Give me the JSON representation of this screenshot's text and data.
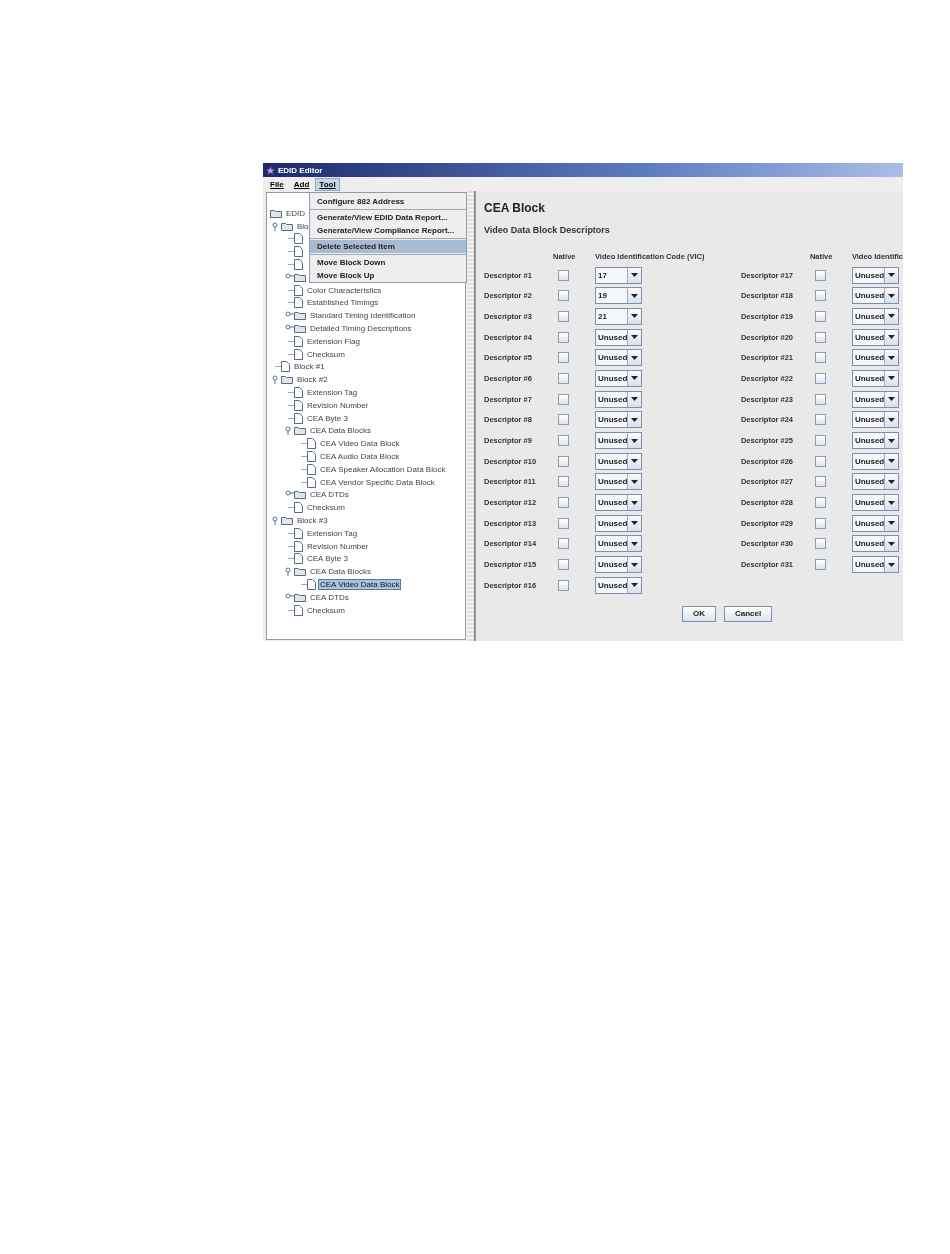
{
  "window": {
    "title": "EDID Editor"
  },
  "menu_bar": [
    {
      "label": "File",
      "selected": false
    },
    {
      "label": "Add",
      "selected": false
    },
    {
      "label": "Tool",
      "selected": true
    }
  ],
  "open_menu": {
    "items": [
      {
        "kind": "item",
        "label": "Configure 882 Address",
        "selected": false
      },
      {
        "kind": "separator"
      },
      {
        "kind": "item",
        "label": "Generate/View EDID Data Report...",
        "selected": false
      },
      {
        "kind": "item",
        "label": "Generate/View Compliance Report...",
        "selected": false
      },
      {
        "kind": "separator"
      },
      {
        "kind": "item",
        "label": "Delete Selected Item",
        "selected": true
      },
      {
        "kind": "separator"
      },
      {
        "kind": "item",
        "label": "Move Block Down",
        "selected": false
      },
      {
        "kind": "item",
        "label": "Move Block Up",
        "selected": false
      }
    ]
  },
  "tree": {
    "root": {
      "label": "EDID",
      "kind": "folder",
      "selected": false,
      "children": [
        {
          "label": "Blo",
          "kind": "folder",
          "expanded": true,
          "selected": false,
          "children": [
            {
              "kind": "file"
            },
            {
              "kind": "file"
            },
            {
              "kind": "file"
            },
            {
              "kind": "folder",
              "expanded": false
            },
            {
              "label": "Color Characteristics",
              "kind": "file",
              "selected": false
            },
            {
              "label": "Established Timings",
              "kind": "file",
              "selected": false
            },
            {
              "label": "Standard Timing Identification",
              "kind": "folder",
              "expanded": false,
              "selected": false
            },
            {
              "label": "Detailed Timing Descriptions",
              "kind": "folder",
              "expanded": false,
              "selected": false
            },
            {
              "label": "Extension Flag",
              "kind": "file",
              "selected": false
            },
            {
              "label": "Checksum",
              "kind": "file",
              "selected": false
            }
          ]
        },
        {
          "label": "Block #1",
          "kind": "file",
          "selected": false
        },
        {
          "label": "Block #2",
          "kind": "folder",
          "expanded": true,
          "selected": false,
          "children": [
            {
              "label": "Extension Tag",
              "kind": "file",
              "selected": false
            },
            {
              "label": "Revision Number",
              "kind": "file",
              "selected": false
            },
            {
              "label": "CEA Byte 3",
              "kind": "file",
              "selected": false
            },
            {
              "label": "CEA Data Blocks",
              "kind": "folder",
              "expanded": true,
              "selected": false,
              "children": [
                {
                  "label": "CEA Video Data Block",
                  "kind": "file",
                  "selected": false
                },
                {
                  "label": "CEA Audio Data Block",
                  "kind": "file",
                  "selected": false
                },
                {
                  "label": "CEA Speaker Allocation Data Block",
                  "kind": "file",
                  "selected": false
                },
                {
                  "label": "CEA Vendor Specific Data Block",
                  "kind": "file",
                  "selected": false
                }
              ]
            },
            {
              "label": "CEA DTDs",
              "kind": "folder",
              "expanded": false,
              "selected": false
            },
            {
              "label": "Checksum",
              "kind": "file",
              "selected": false
            }
          ]
        },
        {
          "label": "Block #3",
          "kind": "folder",
          "expanded": true,
          "selected": false,
          "children": [
            {
              "label": "Extension Tag",
              "kind": "file",
              "selected": false
            },
            {
              "label": "Revision Number",
              "kind": "file",
              "selected": false
            },
            {
              "label": "CEA Byte 3",
              "kind": "file",
              "selected": false
            },
            {
              "label": "CEA Data Blocks",
              "kind": "folder",
              "expanded": true,
              "selected": false,
              "children": [
                {
                  "label": "CEA Video Data Block",
                  "kind": "file",
                  "selected": true
                }
              ]
            },
            {
              "label": "CEA DTDs",
              "kind": "folder",
              "expanded": false,
              "selected": false
            },
            {
              "label": "Checksum",
              "kind": "file",
              "selected": false
            }
          ]
        }
      ]
    }
  },
  "panel": {
    "title": "CEA Block",
    "subtitle": "Video Data Block Descriptors",
    "groups": [
      {
        "native_header": "Native",
        "vic_header": "Video Identification Code (VIC)",
        "rows": [
          {
            "label": "Descriptor #1",
            "native": false,
            "vic": "17"
          },
          {
            "label": "Descriptor #2",
            "native": false,
            "vic": "19"
          },
          {
            "label": "Descriptor #3",
            "native": false,
            "vic": "21"
          },
          {
            "label": "Descriptor #4",
            "native": false,
            "vic": "Unused"
          },
          {
            "label": "Descriptor #5",
            "native": false,
            "vic": "Unused"
          },
          {
            "label": "Descriptor #6",
            "native": false,
            "vic": "Unused"
          },
          {
            "label": "Descriptor #7",
            "native": false,
            "vic": "Unused"
          },
          {
            "label": "Descriptor #8",
            "native": false,
            "vic": "Unused"
          },
          {
            "label": "Descriptor #9",
            "native": false,
            "vic": "Unused"
          },
          {
            "label": "Descriptor #10",
            "native": false,
            "vic": "Unused"
          },
          {
            "label": "Descriptor #11",
            "native": false,
            "vic": "Unused"
          },
          {
            "label": "Descriptor #12",
            "native": false,
            "vic": "Unused"
          },
          {
            "label": "Descriptor #13",
            "native": false,
            "vic": "Unused"
          },
          {
            "label": "Descriptor #14",
            "native": false,
            "vic": "Unused"
          },
          {
            "label": "Descriptor #15",
            "native": false,
            "vic": "Unused"
          },
          {
            "label": "Descriptor #16",
            "native": false,
            "vic": "Unused"
          }
        ]
      },
      {
        "native_header": "Native",
        "vic_header": "Video Identific",
        "rows": [
          {
            "label": "Descriptor #17",
            "native": false,
            "vic": "Unused"
          },
          {
            "label": "Descriptor #18",
            "native": false,
            "vic": "Unused"
          },
          {
            "label": "Descriptor #19",
            "native": false,
            "vic": "Unused"
          },
          {
            "label": "Descriptor #20",
            "native": false,
            "vic": "Unused"
          },
          {
            "label": "Descriptor #21",
            "native": false,
            "vic": "Unused"
          },
          {
            "label": "Descriptor #22",
            "native": false,
            "vic": "Unused"
          },
          {
            "label": "Descriptor #23",
            "native": false,
            "vic": "Unused"
          },
          {
            "label": "Descriptor #24",
            "native": false,
            "vic": "Unused"
          },
          {
            "label": "Descriptor #25",
            "native": false,
            "vic": "Unused"
          },
          {
            "label": "Descriptor #26",
            "native": false,
            "vic": "Unused"
          },
          {
            "label": "Descriptor #27",
            "native": false,
            "vic": "Unused"
          },
          {
            "label": "Descriptor #28",
            "native": false,
            "vic": "Unused"
          },
          {
            "label": "Descriptor #29",
            "native": false,
            "vic": "Unused"
          },
          {
            "label": "Descriptor #30",
            "native": false,
            "vic": "Unused"
          },
          {
            "label": "Descriptor #31",
            "native": false,
            "vic": "Unused"
          }
        ]
      }
    ],
    "buttons": [
      "OK",
      "Cancel"
    ]
  }
}
